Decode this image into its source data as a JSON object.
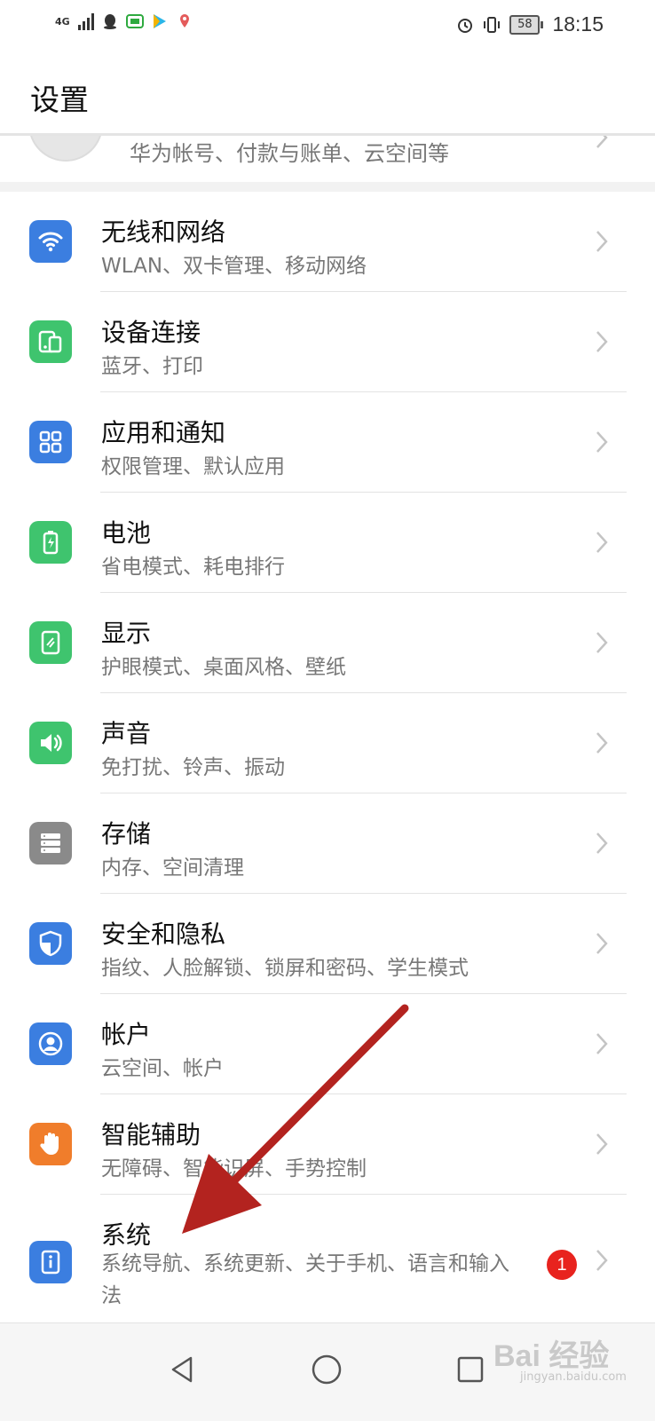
{
  "status_bar": {
    "network_label": "4G",
    "battery_level": "58",
    "time": "18:15",
    "left_icons": [
      "signal-icon",
      "qq-icon",
      "iqiyi-icon",
      "play-store-icon",
      "map-pin-icon"
    ],
    "right_icons": [
      "alarm-icon",
      "vibrate-icon",
      "battery-icon"
    ]
  },
  "header": {
    "title": "设置"
  },
  "account": {
    "subtitle": "华为帐号、付款与账单、云空间等"
  },
  "settings": {
    "items": [
      {
        "title": "无线和网络",
        "subtitle": "WLAN、双卡管理、移动网络",
        "icon": "wifi-icon",
        "color": "#3b7ee0"
      },
      {
        "title": "设备连接",
        "subtitle": "蓝牙、打印",
        "icon": "device-connect-icon",
        "color": "#3fc46e"
      },
      {
        "title": "应用和通知",
        "subtitle": "权限管理、默认应用",
        "icon": "apps-grid-icon",
        "color": "#3b7ee0"
      },
      {
        "title": "电池",
        "subtitle": "省电模式、耗电排行",
        "icon": "battery-charge-icon",
        "color": "#3fc46e"
      },
      {
        "title": "显示",
        "subtitle": "护眼模式、桌面风格、壁纸",
        "icon": "display-icon",
        "color": "#3fc46e"
      },
      {
        "title": "声音",
        "subtitle": "免打扰、铃声、振动",
        "icon": "speaker-icon",
        "color": "#3fc46e"
      },
      {
        "title": "存储",
        "subtitle": "内存、空间清理",
        "icon": "storage-icon",
        "color": "#8a8a8a"
      },
      {
        "title": "安全和隐私",
        "subtitle": "指纹、人脸解锁、锁屏和密码、学生模式",
        "icon": "shield-icon",
        "color": "#3b7ee0"
      },
      {
        "title": "帐户",
        "subtitle": "云空间、帐户",
        "icon": "account-icon",
        "color": "#3b7ee0"
      },
      {
        "title": "智能辅助",
        "subtitle": "无障碍、智能识屏、手势控制",
        "icon": "hand-icon",
        "color": "#f07d2b"
      },
      {
        "title": "系统",
        "subtitle": "系统导航、系统更新、关于手机、语言和输入法",
        "icon": "system-info-icon",
        "color": "#3b7ee0",
        "badge": "1"
      }
    ]
  },
  "navbar": {
    "buttons": [
      "back-icon",
      "home-icon",
      "recent-apps-icon"
    ]
  },
  "watermark": {
    "brand": "Bai 经验",
    "url": "jingyan.baidu.com"
  },
  "annotation": {
    "arrow_color": "#b3231f"
  }
}
